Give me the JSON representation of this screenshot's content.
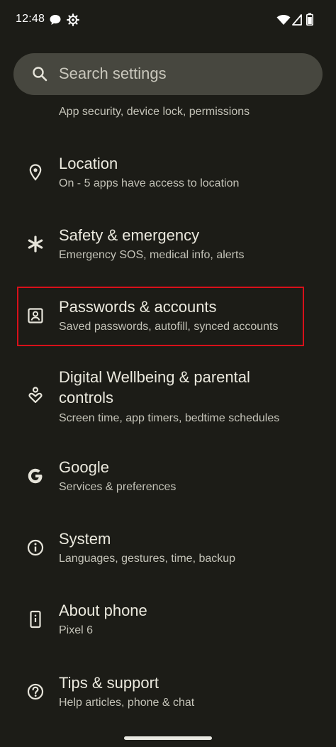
{
  "status_bar": {
    "time": "12:48"
  },
  "search": {
    "placeholder": "Search settings"
  },
  "partial_item": {
    "subtitle": "App security, device lock, permissions"
  },
  "settings_items": [
    {
      "title": "Location",
      "subtitle": "On - 5 apps have access to location",
      "icon": "location-pin-icon"
    },
    {
      "title": "Safety & emergency",
      "subtitle": "Emergency SOS, medical info, alerts",
      "icon": "asterisk-icon"
    },
    {
      "title": "Passwords & accounts",
      "subtitle": "Saved passwords, autofill, synced accounts",
      "icon": "account-box-icon"
    },
    {
      "title_line1": "Digital Wellbeing & parental",
      "title_line2": "controls",
      "subtitle": "Screen time, app timers, bedtime schedules",
      "icon": "wellbeing-icon"
    },
    {
      "title": "Google",
      "subtitle": "Services & preferences",
      "icon": "google-g-icon"
    },
    {
      "title": "System",
      "subtitle": "Languages, gestures, time, backup",
      "icon": "info-icon"
    },
    {
      "title": "About phone",
      "subtitle": "Pixel 6",
      "icon": "phone-icon"
    },
    {
      "title": "Tips & support",
      "subtitle": "Help articles, phone & chat",
      "icon": "help-icon"
    }
  ],
  "colors": {
    "background": "#1c1c17",
    "search_bg": "#47473f",
    "highlight": "#d8101a"
  }
}
